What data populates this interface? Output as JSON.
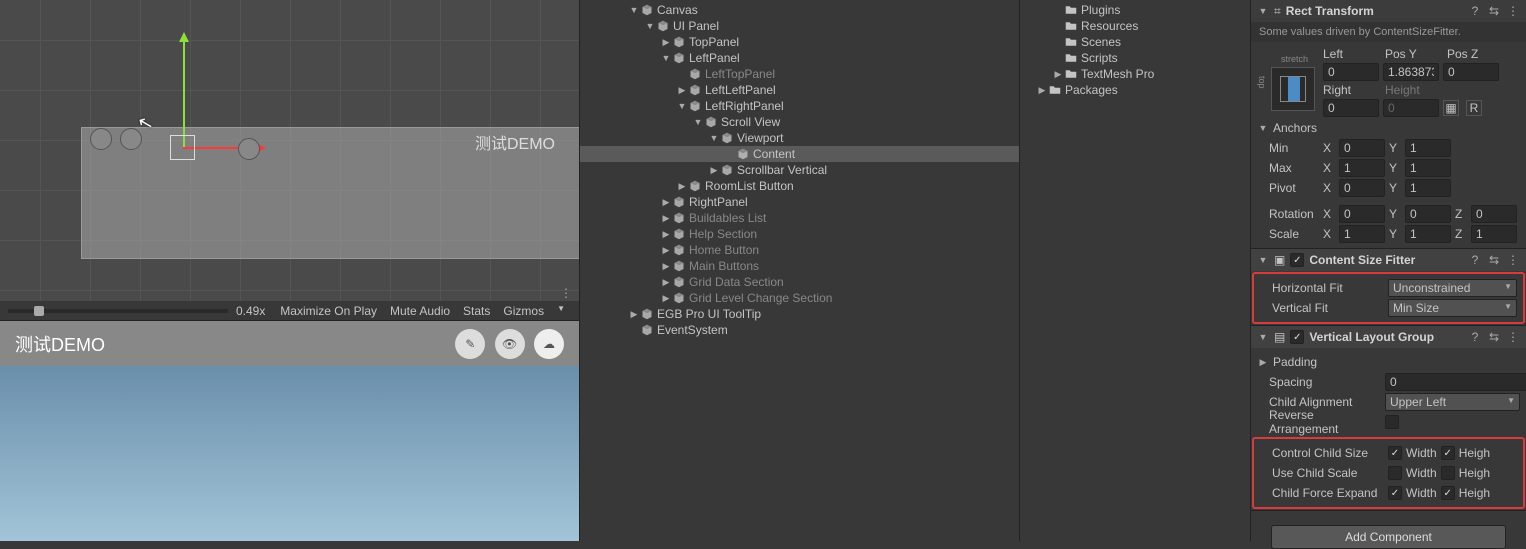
{
  "scene": {
    "label": "测试DEMO",
    "zoom": "0.49x"
  },
  "game_toolbar": {
    "maximize": "Maximize On Play",
    "mute": "Mute Audio",
    "stats": "Stats",
    "gizmos": "Gizmos"
  },
  "game": {
    "title": "测试DEMO"
  },
  "hierarchy": [
    {
      "d": 3,
      "f": "v",
      "name": "Canvas",
      "ico": "go"
    },
    {
      "d": 4,
      "f": "v",
      "name": "UI Panel",
      "ico": "go"
    },
    {
      "d": 5,
      "f": "h",
      "name": "TopPanel",
      "ico": "go"
    },
    {
      "d": 5,
      "f": "v",
      "name": "LeftPanel",
      "ico": "go"
    },
    {
      "d": 6,
      "f": "n",
      "name": "LeftTopPanel",
      "ico": "go",
      "muted": true
    },
    {
      "d": 6,
      "f": "h",
      "name": "LeftLeftPanel",
      "ico": "go"
    },
    {
      "d": 6,
      "f": "v",
      "name": "LeftRightPanel",
      "ico": "go"
    },
    {
      "d": 7,
      "f": "v",
      "name": "Scroll View",
      "ico": "go"
    },
    {
      "d": 8,
      "f": "v",
      "name": "Viewport",
      "ico": "go"
    },
    {
      "d": 9,
      "f": "n",
      "name": "Content",
      "ico": "go",
      "sel": true
    },
    {
      "d": 8,
      "f": "h",
      "name": "Scrollbar Vertical",
      "ico": "go"
    },
    {
      "d": 6,
      "f": "h",
      "name": "RoomList Button",
      "ico": "go"
    },
    {
      "d": 5,
      "f": "h",
      "name": "RightPanel",
      "ico": "go"
    },
    {
      "d": 5,
      "f": "h",
      "name": "Buildables List",
      "ico": "go",
      "muted": true
    },
    {
      "d": 5,
      "f": "h",
      "name": "Help Section",
      "ico": "go",
      "muted": true
    },
    {
      "d": 5,
      "f": "h",
      "name": "Home Button",
      "ico": "go",
      "muted": true
    },
    {
      "d": 5,
      "f": "h",
      "name": "Main Buttons",
      "ico": "go",
      "muted": true
    },
    {
      "d": 5,
      "f": "h",
      "name": "Grid Data Section",
      "ico": "go",
      "muted": true
    },
    {
      "d": 5,
      "f": "h",
      "name": "Grid Level Change Section",
      "ico": "go",
      "muted": true
    },
    {
      "d": 3,
      "f": "h",
      "name": "EGB Pro UI ToolTip",
      "ico": "go"
    },
    {
      "d": 3,
      "f": "n",
      "name": "EventSystem",
      "ico": "go"
    }
  ],
  "project": [
    {
      "d": 2,
      "f": "n",
      "name": "Plugins",
      "ico": "folder",
      "muted": true
    },
    {
      "d": 2,
      "f": "n",
      "name": "Resources",
      "ico": "folder"
    },
    {
      "d": 2,
      "f": "n",
      "name": "Scenes",
      "ico": "folder"
    },
    {
      "d": 2,
      "f": "n",
      "name": "Scripts",
      "ico": "folder"
    },
    {
      "d": 2,
      "f": "h",
      "name": "TextMesh Pro",
      "ico": "folder"
    },
    {
      "d": 1,
      "f": "h",
      "name": "Packages",
      "ico": "folder",
      "bold": true
    }
  ],
  "inspector": {
    "rect_transform": {
      "title": "Rect Transform",
      "hint": "Some values driven by ContentSizeFitter.",
      "anchor_h": "stretch",
      "anchor_v": "top",
      "left_lbl": "Left",
      "left": "0",
      "posy_lbl": "Pos Y",
      "posy": "1.8638736",
      "posz_lbl": "Pos Z",
      "posz": "0",
      "right_lbl": "Right",
      "right": "0",
      "height_lbl": "Height",
      "height": "0",
      "anchors_lbl": "Anchors",
      "min_lbl": "Min",
      "min_x": "0",
      "min_y": "1",
      "max_lbl": "Max",
      "max_x": "1",
      "max_y": "1",
      "pivot_lbl": "Pivot",
      "pivot_x": "0",
      "pivot_y": "1",
      "rot_lbl": "Rotation",
      "rot_x": "0",
      "rot_y": "0",
      "rot_z": "0",
      "scale_lbl": "Scale",
      "scale_x": "1",
      "scale_y": "1",
      "scale_z": "1"
    },
    "csf": {
      "title": "Content Size Fitter",
      "hfit_lbl": "Horizontal Fit",
      "hfit": "Unconstrained",
      "vfit_lbl": "Vertical Fit",
      "vfit": "Min Size"
    },
    "vlg": {
      "title": "Vertical Layout Group",
      "padding_lbl": "Padding",
      "spacing_lbl": "Spacing",
      "spacing": "0",
      "align_lbl": "Child Alignment",
      "align": "Upper Left",
      "reverse_lbl": "Reverse Arrangement",
      "reverse": false,
      "ctrl_lbl": "Control Child Size",
      "ctrl_w": true,
      "ctrl_h": true,
      "usescale_lbl": "Use Child Scale",
      "usescale_w": false,
      "usescale_h": false,
      "expand_lbl": "Child Force Expand",
      "expand_w": true,
      "expand_h": true,
      "width_lbl": "Width",
      "height_lbl": "Heigh"
    },
    "add_component": "Add Component"
  }
}
